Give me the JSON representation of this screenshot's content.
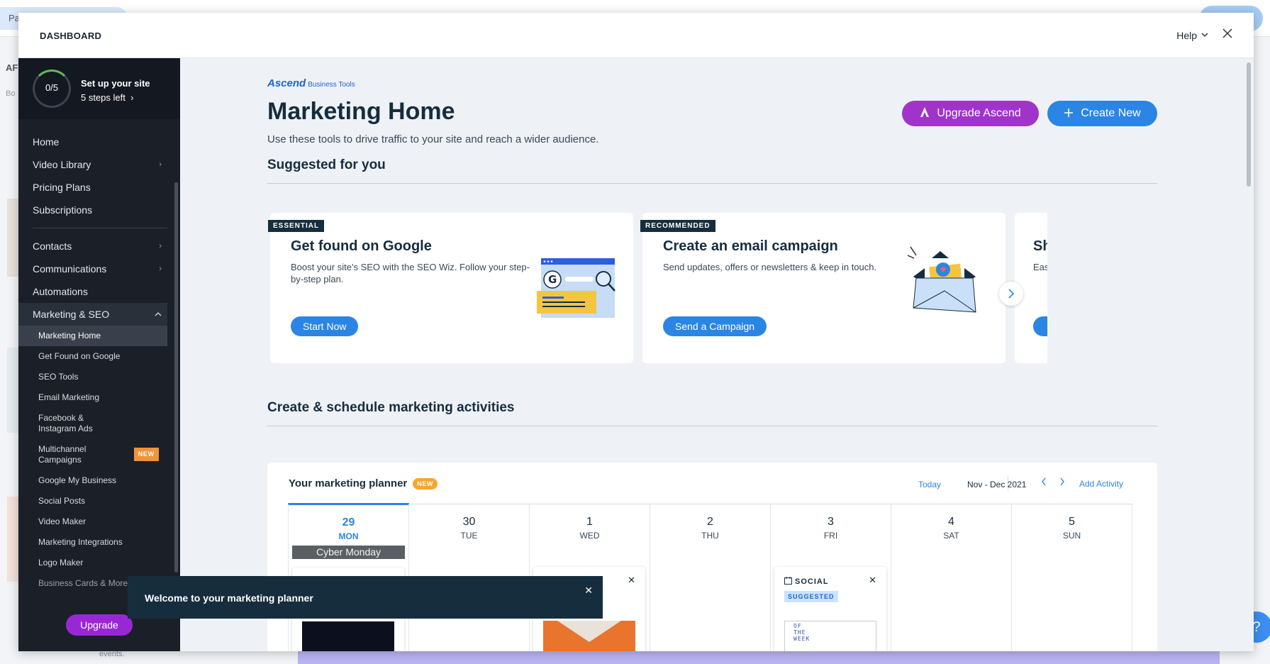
{
  "modal": {
    "title": "DASHBOARD",
    "help": "Help"
  },
  "setup": {
    "progress": "0/5",
    "title": "Set up your site",
    "steps": "5 steps left"
  },
  "nav": {
    "home": "Home",
    "video_library": "Video Library",
    "pricing_plans": "Pricing Plans",
    "subscriptions": "Subscriptions",
    "contacts": "Contacts",
    "communications": "Communications",
    "automations": "Automations",
    "marketing_seo": "Marketing & SEO",
    "sub": {
      "marketing_home": "Marketing Home",
      "get_found": "Get Found on Google",
      "seo_tools": "SEO Tools",
      "email_marketing": "Email Marketing",
      "facebook_ads": "Facebook & Instagram Ads",
      "multichannel": "Multichannel Campaigns",
      "multichannel_badge": "NEW",
      "gmb": "Google My Business",
      "social_posts": "Social Posts",
      "video_maker": "Video Maker",
      "integrations": "Marketing Integrations",
      "logo_maker": "Logo Maker",
      "business_cards": "Business Cards & More"
    },
    "upgrade": "Upgrade"
  },
  "main": {
    "logo_brand": "Ascend",
    "logo_tools": "Business Tools",
    "title": "Marketing Home",
    "subtitle": "Use these tools to drive traffic to your site and reach a wider audience.",
    "upgrade_btn": "Upgrade Ascend",
    "create_btn": "Create New",
    "suggested_title": "Suggested for you",
    "schedule_title": "Create & schedule marketing activities"
  },
  "cards": [
    {
      "tag": "ESSENTIAL",
      "title": "Get found on Google",
      "desc": "Boost your site's SEO with the SEO Wiz. Follow your step-by-step plan.",
      "button": "Start Now"
    },
    {
      "tag": "RECOMMENDED",
      "title": "Create an email campaign",
      "desc": "Send updates, offers or newsletters & keep in touch.",
      "button": "Send a Campaign"
    },
    {
      "title": "Sh",
      "desc": "Eas"
    }
  ],
  "planner": {
    "title": "Your marketing planner",
    "badge": "NEW",
    "today": "Today",
    "range": "Nov - Dec 2021",
    "add": "Add Activity",
    "days": [
      {
        "num": "29",
        "name": "MON"
      },
      {
        "num": "30",
        "name": "TUE"
      },
      {
        "num": "1",
        "name": "WED"
      },
      {
        "num": "2",
        "name": "THU"
      },
      {
        "num": "3",
        "name": "FRI"
      },
      {
        "num": "4",
        "name": "SAT"
      },
      {
        "num": "5",
        "name": "SUN"
      }
    ],
    "holiday": "Cyber Monday",
    "social_label": "SOCIAL",
    "suggested_label": "SUGGESTED",
    "thumb_text": "OF THE WEEK"
  },
  "toast": {
    "text": "Welcome to your marketing planner"
  },
  "background": {
    "pill": "Pa",
    "left_a": "AF",
    "left_b": "Bo",
    "events": "events."
  },
  "colors": {
    "accent": "#2b85e4",
    "purple": "#a034c9",
    "sidebar": "#1b2028",
    "new_badge": "#f29338"
  }
}
